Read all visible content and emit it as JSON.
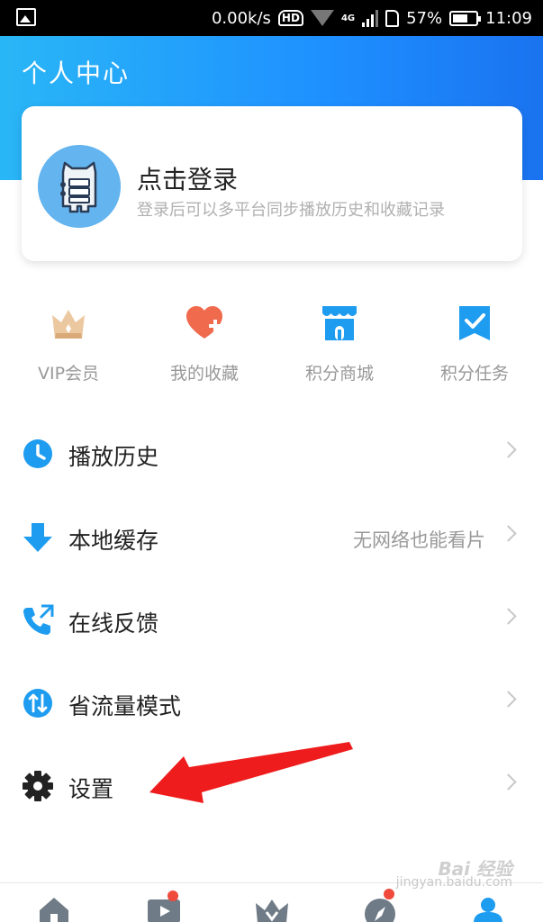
{
  "status_bar": {
    "net_speed": "0.00k/s",
    "hd_label": "HD",
    "network_type": "4G",
    "battery_percent": "57%",
    "time": "11:09"
  },
  "header": {
    "title": "个人中心"
  },
  "login_card": {
    "title": "点击登录",
    "subtitle": "登录后可以多平台同步播放历史和收藏记录"
  },
  "quick_actions": [
    {
      "label": "VIP会员",
      "icon": "crown-icon",
      "color": "#e6b88a"
    },
    {
      "label": "我的收藏",
      "icon": "heart-plus-icon",
      "color": "#f06a4e"
    },
    {
      "label": "积分商城",
      "icon": "store-icon",
      "color": "#1e9cf0"
    },
    {
      "label": "积分任务",
      "icon": "task-check-icon",
      "color": "#1e9cf0"
    }
  ],
  "menu": [
    {
      "label": "播放历史",
      "icon": "clock-icon",
      "extra": ""
    },
    {
      "label": "本地缓存",
      "icon": "download-arrow-icon",
      "extra": "无网络也能看片"
    },
    {
      "label": "在线反馈",
      "icon": "phone-feedback-icon",
      "extra": ""
    },
    {
      "label": "省流量模式",
      "icon": "data-saver-icon",
      "extra": ""
    },
    {
      "label": "设置",
      "icon": "gear-icon",
      "extra": ""
    }
  ],
  "bottom_nav": [
    {
      "icon": "home-icon",
      "badge": false
    },
    {
      "icon": "play-icon",
      "badge": true
    },
    {
      "icon": "vip-crown-icon",
      "badge": false
    },
    {
      "icon": "compass-icon",
      "badge": true
    },
    {
      "icon": "profile-icon",
      "badge": false,
      "active": true
    }
  ],
  "watermark": {
    "brand": "Bai 经验",
    "url": "jingyan.baidu.com"
  },
  "colors": {
    "accent": "#1e90ff",
    "badge": "#f04a3c",
    "annotation": "#ee1c1c"
  }
}
